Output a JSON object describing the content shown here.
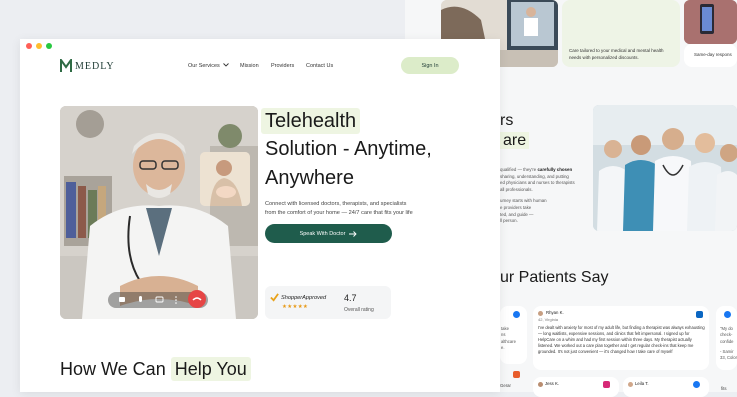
{
  "brand": {
    "name": "MEDLY",
    "accent": "#1f5c4c",
    "mint": "#dcecc9"
  },
  "nav": {
    "services": "Our Services",
    "mission": "Mission",
    "providers": "Providers",
    "contact": "Contact Us",
    "signin": "Sign In"
  },
  "hero": {
    "line1": "Telehealth",
    "line2": "Solution - Anytime,",
    "line3": "Anywhere",
    "sub1": "Connect with licensed doctors, therapists, and specialists",
    "sub2": "from the comfort of your home — 24/7 care that fits your life",
    "cta": "Speak With Doctor",
    "rating_brand": "ShopperApproved",
    "rating_value": "4.7",
    "rating_label": "Overall rating"
  },
  "how": {
    "lead": "How We Can ",
    "highlight": "Help You"
  },
  "bg": {
    "card1": "Care tailored to your medical and mental health needs with personalized discounts.",
    "card2": "Same-day respons",
    "side_heading_1": "rs",
    "side_heading_2": "are",
    "side_text_1": "qualified — they're",
    "side_text_1b": "carefully chosen",
    "side_text_2": "sharing, understanding, and putting",
    "side_text_3": "ed physicians and nurses to therapists",
    "side_text_4": "all professionals.",
    "side_text_5": "urney starts with human",
    "side_text_6": "e providers take",
    "side_text_7": "ted, and guide —",
    "side_text_8": "ll person.",
    "patients": "ur Patients Say",
    "t1_name": "Rhyan K.",
    "t1_age": "42, Virginia",
    "t1_text": "I've dealt with anxiety for most of my adult life, but finding a therapist was always exhausting — long waitlists, expensive sessions, and clinics that felt impersonal. I signed up for HelpCare on a whim and had my first session within three days. My therapist actually listened. We worked out a care plan together and I get regular check-ins that keep me grounded. It's not just convenient — it's changed how I take care of myself",
    "t2_name": "Jess K.",
    "t3_name": "Leila T.",
    "r1": "\"My do",
    "r2": "check-",
    "r3": "confide",
    "r4": "- Samir",
    "r5": "33, Color",
    "l1": "take",
    "l2": "ns",
    "l3": "althcare",
    "l4": "e.",
    "l5": "Gerar",
    "l6": "fits"
  }
}
